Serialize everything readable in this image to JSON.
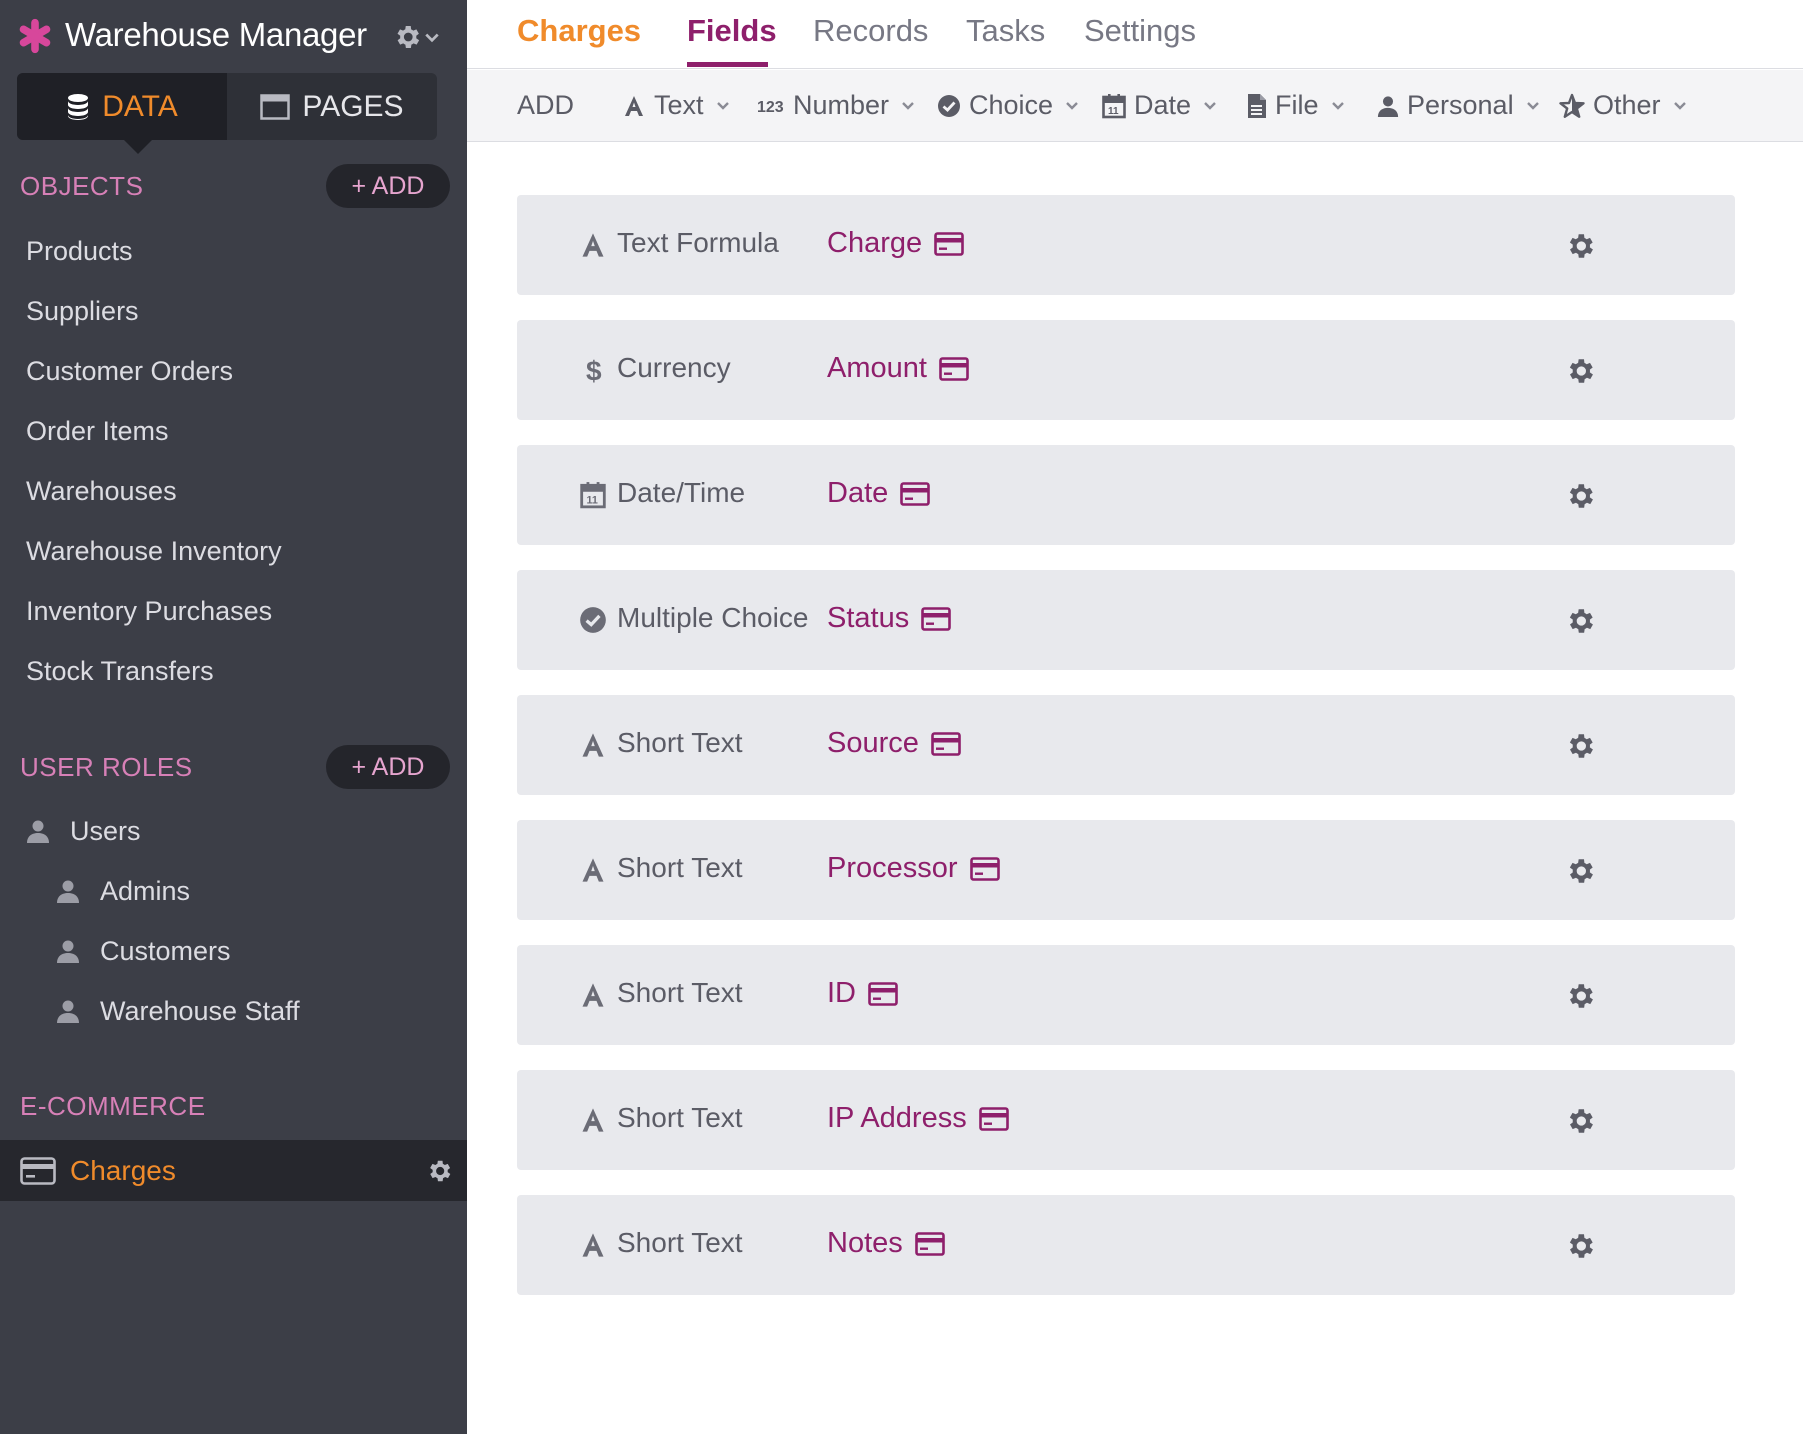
{
  "app": {
    "title": "Warehouse Manager"
  },
  "mode_switch": {
    "data_label": "DATA",
    "pages_label": "PAGES"
  },
  "objects": {
    "section_title": "OBJECTS",
    "add_label": "+ ADD",
    "items": [
      "Products",
      "Suppliers",
      "Customer Orders",
      "Order Items",
      "Warehouses",
      "Warehouse Inventory",
      "Inventory Purchases",
      "Stock Transfers"
    ]
  },
  "user_roles": {
    "section_title": "USER ROLES",
    "add_label": "+ ADD",
    "items": [
      "Users",
      "Admins",
      "Customers",
      "Warehouse Staff"
    ]
  },
  "ecommerce": {
    "section_title": "E-COMMERCE",
    "items": [
      "Charges"
    ]
  },
  "tabs": {
    "object_name": "Charges",
    "items": [
      "Fields",
      "Records",
      "Tasks",
      "Settings"
    ],
    "active": "Fields"
  },
  "toolbar": {
    "add_label": "ADD",
    "types": [
      "Text",
      "Number",
      "Choice",
      "Date",
      "File",
      "Personal",
      "Other"
    ]
  },
  "fields": [
    {
      "type": "Text Formula",
      "name": "Charge",
      "icon": "text-icon"
    },
    {
      "type": "Currency",
      "name": "Amount",
      "icon": "dollar-icon"
    },
    {
      "type": "Date/Time",
      "name": "Date",
      "icon": "calendar-icon"
    },
    {
      "type": "Multiple Choice",
      "name": "Status",
      "icon": "check-circle-icon"
    },
    {
      "type": "Short Text",
      "name": "Source",
      "icon": "text-icon"
    },
    {
      "type": "Short Text",
      "name": "Processor",
      "icon": "text-icon"
    },
    {
      "type": "Short Text",
      "name": "ID",
      "icon": "text-icon"
    },
    {
      "type": "Short Text",
      "name": "IP Address",
      "icon": "text-icon"
    },
    {
      "type": "Short Text",
      "name": "Notes",
      "icon": "text-icon"
    }
  ],
  "colors": {
    "sidebar_bg": "#3c3e47",
    "accent_orange": "#f08b2b",
    "accent_pink": "#d780b7",
    "field_name": "#8e1f6b",
    "row_bg": "#e8e9ed"
  }
}
